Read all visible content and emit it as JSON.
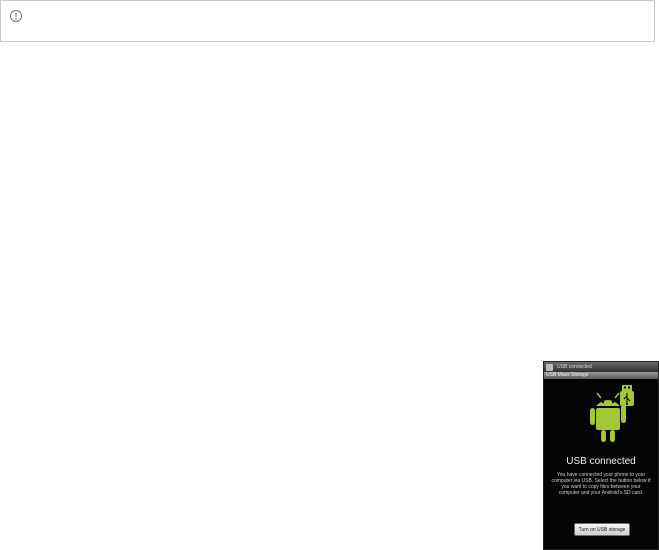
{
  "notice": {
    "icon": "info-circle-icon"
  },
  "phone": {
    "status_bar": {
      "notification_icon": "usb-app-icon",
      "text": "USB connected"
    },
    "title_bar": {
      "text": "USB Mass Storage"
    },
    "artwork": {
      "android_icon": "android-robot-icon",
      "usb_icon": "usb-icon",
      "accent": "#a4c639"
    },
    "heading": "USB connected",
    "message": "You have connected your phone to your computer via USB. Select the button below if you want to copy files between your computer and your Android's SD card.",
    "button_label": "Turn on USB storage"
  }
}
